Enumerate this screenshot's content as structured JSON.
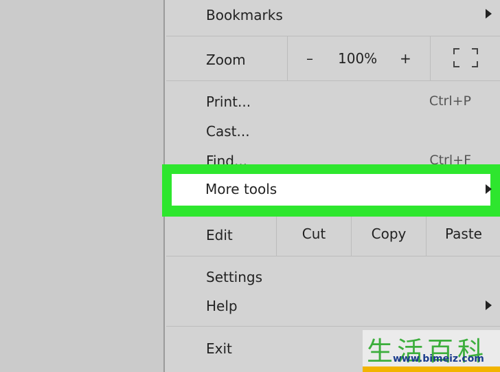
{
  "menu": {
    "bookmarks": "Bookmarks",
    "zoom": {
      "label": "Zoom",
      "minus": "–",
      "value": "100%",
      "plus": "+"
    },
    "print": {
      "label": "Print...",
      "shortcut": "Ctrl+P"
    },
    "cast": "Cast...",
    "find": {
      "label": "Find...",
      "shortcut": "Ctrl+F"
    },
    "more_tools": "More tools",
    "edit": {
      "label": "Edit",
      "cut": "Cut",
      "copy": "Copy",
      "paste": "Paste"
    },
    "settings": "Settings",
    "help": "Help",
    "exit": "Exit"
  },
  "highlight_color": "#2EE62E",
  "watermark": {
    "chars": "生活百科",
    "url": "www.bimeiz.com"
  }
}
